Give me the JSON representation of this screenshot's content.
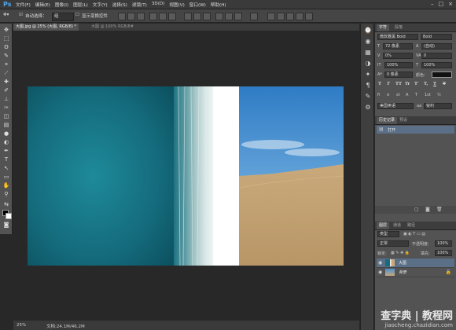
{
  "app": {
    "logo": "Ps"
  },
  "menubar": {
    "items": [
      "文件(F)",
      "编辑(E)",
      "图像(I)",
      "图层(L)",
      "文字(Y)",
      "选择(S)",
      "滤镜(T)",
      "3D(D)",
      "视图(V)",
      "窗口(W)",
      "帮助(H)"
    ]
  },
  "options": {
    "auto_select_label": "自动选择：",
    "auto_select_value": "组",
    "transform_label": "显示变换控件"
  },
  "tabs": [
    {
      "label": "大图.jpg @ 25% (大图, RGB/8) *"
    },
    {
      "label": "大图 @ 100% RGB/8#"
    }
  ],
  "status": {
    "zoom": "25%",
    "doc": "文档:24.1M/46.2M"
  },
  "character": {
    "tabs": [
      "字符",
      "段落"
    ],
    "font_family": "微软雅黑 Bold",
    "font_style": "Bold",
    "size": "72 像素",
    "leading": "(自动)",
    "tracking": "0",
    "kerning": "0%",
    "vscale": "100%",
    "hscale": "100%",
    "baseline": "0 像素",
    "color_label": "颜色：",
    "type_buttons": [
      "T",
      "T",
      "TT",
      "Tr",
      "T'",
      "T,",
      "T",
      "T"
    ],
    "lang": "美国英语",
    "aa": "锐利"
  },
  "history": {
    "tabs": [
      "历史记录",
      "预设"
    ],
    "item": "打开"
  },
  "layers": {
    "tabs": [
      "图层",
      "通道",
      "路径"
    ],
    "kind": "类型",
    "blend_mode": "正常",
    "opacity_label": "不透明度:",
    "opacity": "100%",
    "lock_label": "锁定:",
    "fill_label": "填充:",
    "fill": "100%",
    "items": [
      {
        "name": "大图",
        "selected": true
      },
      {
        "name": "背景",
        "selected": false
      }
    ]
  },
  "watermark": {
    "line1": "查字典 | 教程网",
    "line2": "jiaocheng.chazidian.com"
  },
  "colors": {
    "accent": "#4fa6e6",
    "panel": "#535353",
    "selected": "#5b6f86"
  }
}
